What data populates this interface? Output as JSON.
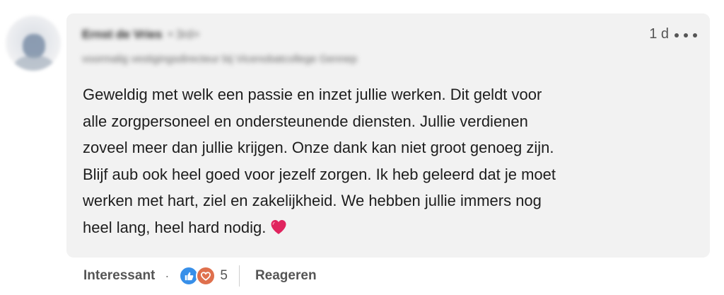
{
  "comment": {
    "author_name": "Ernst de Vries",
    "author_degree": "• 3rd+",
    "author_headline": "voormalig vestigingsdirecteur bij Vicenobatcollege Gennep",
    "timestamp": "1 d",
    "text": "Geweldig met welk een passie en inzet jullie werken. Dit geldt voor\nalle zorgpersoneel en ondersteunende diensten. Jullie verdienen\nzoveel meer dan jullie krijgen. Onze dank kan niet groot genoeg zijn.\nBlijf aub ook heel goed voor jezelf zorgen. Ik heb geleerd dat je moet\nwerken met hart, ziel en zakelijkheid. We hebben jullie immers nog\nheel lang, heel hard nodig.",
    "emoji": "heart-emoji"
  },
  "actions": {
    "reaction_label": "Interessant",
    "separator": "·",
    "reaction_icons": [
      "like-icon",
      "love-icon"
    ],
    "reaction_count": "5",
    "reply_label": "Reageren"
  },
  "colors": {
    "bubble_bg": "#f2f2f2",
    "like": "#378fe9",
    "love": "#df704d",
    "heart": "#e0245e",
    "text": "#1d1d1d",
    "muted": "#555555"
  }
}
